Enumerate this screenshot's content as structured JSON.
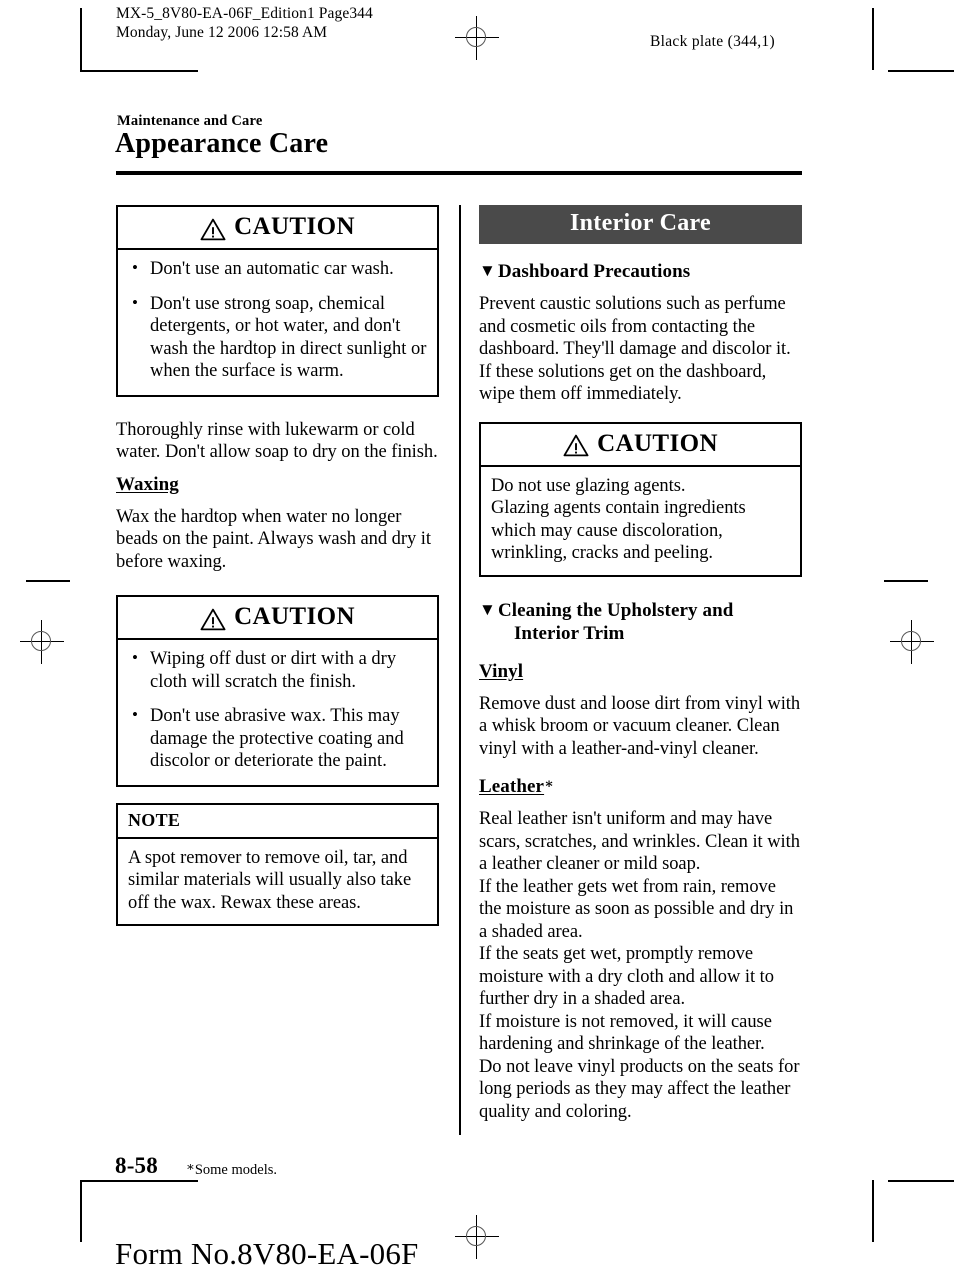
{
  "print_marks": {
    "registration_icon": "registration-crosshair-icon"
  },
  "header": {
    "file_line": "MX-5_8V80-EA-06F_Edition1 Page344\nMonday, June 12 2006 12:58 AM",
    "plate_info": "Black plate (344,1)"
  },
  "title_block": {
    "kicker": "Maintenance and Care",
    "title": "Appearance Care"
  },
  "left_column": {
    "caution_wash": {
      "label": "CAUTION",
      "icon": "warning-triangle-icon",
      "bullets": [
        "Don't use an automatic car wash.",
        "Don't use strong soap, chemical detergents, or hot water, and don't wash the hardtop in direct sunlight or when the surface is warm."
      ]
    },
    "rinse_paragraph": "Thoroughly rinse with lukewarm or cold water. Don't allow soap to dry on the finish.",
    "waxing_heading": "Waxing",
    "waxing_paragraph": "Wax the hardtop when water no longer beads on the paint. Always wash and dry it before waxing.",
    "caution_wax": {
      "label": "CAUTION",
      "icon": "warning-triangle-icon",
      "bullets": [
        "Wiping off dust or dirt with a dry cloth will scratch the finish.",
        "Don't use abrasive wax. This may damage the protective coating and discolor or deteriorate the paint."
      ]
    },
    "note_box": {
      "label": "NOTE",
      "text": "A spot remover to remove oil, tar, and similar materials will usually also take off the wax. Rewax these areas."
    }
  },
  "right_column": {
    "banner": "Interior Care",
    "banner_bg": "#4a4a4a",
    "banner_fg": "#ffffff",
    "dashboard_heading": "Dashboard Precautions",
    "dashboard_marker": "triangle-down-icon",
    "dashboard_paragraph": "Prevent caustic solutions such as perfume and cosmetic oils from contacting the dashboard. They'll damage and discolor it. If these solutions get on the dashboard, wipe them off immediately.",
    "caution_glazing": {
      "label": "CAUTION",
      "icon": "warning-triangle-icon",
      "text": "Do not use glazing agents.\nGlazing agents contain ingredients which may cause discoloration, wrinkling, cracks and peeling."
    },
    "upholstery_heading_line1": "Cleaning the Upholstery and",
    "upholstery_heading_line2": "Interior Trim",
    "upholstery_marker": "triangle-down-icon",
    "vinyl_heading": "Vinyl",
    "vinyl_paragraph": "Remove dust and loose dirt from vinyl with a whisk broom or vacuum cleaner. Clean vinyl with a leather-and-vinyl cleaner.",
    "leather_heading": "Leather",
    "leather_heading_mark": "∗",
    "leather_paragraph": "Real leather isn't uniform and may have scars, scratches, and wrinkles. Clean it with a leather cleaner or mild soap.\nIf the leather gets wet from rain, remove the moisture as soon as possible and dry in a shaded area.\nIf the seats get wet, promptly remove moisture with a dry cloth and allow it to further dry in a shaded area.\nIf moisture is not removed, it will cause hardening and shrinkage of the leather.\nDo not leave vinyl products on the seats for long periods as they may affect the leather quality and coloring."
  },
  "footer": {
    "page_number": "8-58",
    "footnote_mark": "∗",
    "footnote_text": "Some models.",
    "form_number": "Form No.8V80-EA-06F"
  }
}
